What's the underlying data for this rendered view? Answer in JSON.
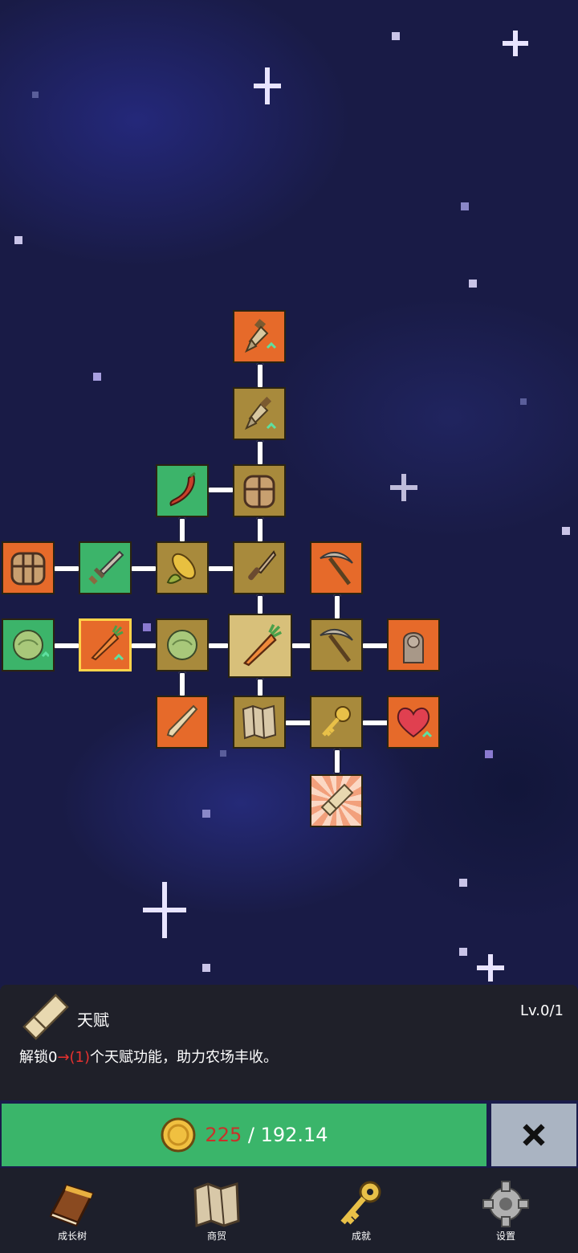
{
  "talent_tree": {
    "nodes": [
      {
        "id": "shovel-top",
        "icon": "shovel-icon",
        "color": "orange"
      },
      {
        "id": "shovel-2",
        "icon": "shovel-icon",
        "color": "brown"
      },
      {
        "id": "pepper",
        "icon": "chili-pepper-icon",
        "color": "green"
      },
      {
        "id": "backpack-center",
        "icon": "backpack-icon",
        "color": "brown"
      },
      {
        "id": "backpack-left",
        "icon": "backpack-icon",
        "color": "orange"
      },
      {
        "id": "sword",
        "icon": "sword-icon",
        "color": "green"
      },
      {
        "id": "corn",
        "icon": "corn-icon",
        "color": "brown"
      },
      {
        "id": "knife",
        "icon": "knife-icon",
        "color": "brown"
      },
      {
        "id": "pickaxe-top",
        "icon": "pickaxe-icon",
        "color": "orange"
      },
      {
        "id": "cabbage-left",
        "icon": "cabbage-icon",
        "color": "green"
      },
      {
        "id": "carrot-selected",
        "icon": "carrot-icon",
        "color": "orange"
      },
      {
        "id": "cabbage",
        "icon": "cabbage-icon",
        "color": "brown"
      },
      {
        "id": "carrot-center",
        "icon": "carrot-icon",
        "color": "center"
      },
      {
        "id": "pickaxe",
        "icon": "pickaxe-icon",
        "color": "brown"
      },
      {
        "id": "statue",
        "icon": "statue-icon",
        "color": "orange"
      },
      {
        "id": "bone",
        "icon": "bone-icon",
        "color": "orange"
      },
      {
        "id": "map",
        "icon": "map-icon",
        "color": "brown"
      },
      {
        "id": "key",
        "icon": "key-icon",
        "color": "brown"
      },
      {
        "id": "heart",
        "icon": "heart-icon",
        "color": "orange"
      },
      {
        "id": "scroll",
        "icon": "scroll-icon",
        "color": "burst"
      }
    ]
  },
  "info_panel": {
    "icon": "scroll-icon",
    "title": "天赋",
    "level": "Lv.0/1",
    "desc_prefix": "解锁0",
    "desc_arrow": "→(1)",
    "desc_suffix": "个天赋功能，助力农场丰收。"
  },
  "purchase": {
    "coin_icon": "gold-coin-icon",
    "current": "225",
    "separator": " / ",
    "cost": "192.14"
  },
  "close_icon": "close-icon",
  "nav": {
    "items": [
      {
        "label": "成长树",
        "icon": "book-icon"
      },
      {
        "label": "商贸",
        "icon": "map-icon"
      },
      {
        "label": "成就",
        "icon": "key-icon"
      },
      {
        "label": "设置",
        "icon": "gear-icon"
      }
    ]
  },
  "colors": {
    "orange": "#e66a2a",
    "brown": "#a88a3c",
    "green": "#3cb46a",
    "center": "#d8c07a",
    "buy_button": "#3ab56a",
    "close_button": "#aab4c2",
    "panel": "#1f2029",
    "nav": "#1d1f2b",
    "accent_red": "#c8322a"
  }
}
